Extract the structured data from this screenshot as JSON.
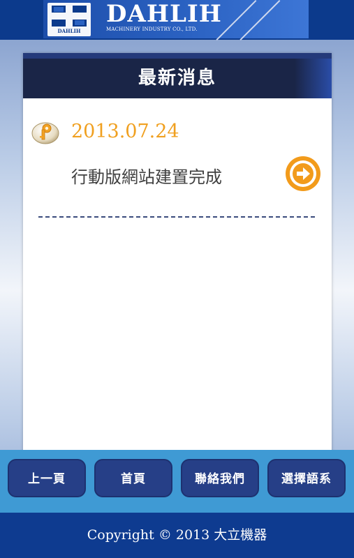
{
  "header": {
    "logo_small_text": "DAHLIH",
    "brand_name": "DAHLIH",
    "brand_subtitle": "MACHINERY INDUSTRY CO., LTD."
  },
  "panel": {
    "title": "最新消息",
    "news": [
      {
        "date": "2013.07.24",
        "title": "行動版網站建置完成",
        "icon": "key-icon",
        "action_icon": "arrow-right-circle-icon"
      }
    ]
  },
  "nav": {
    "prev": "上一頁",
    "home": "首頁",
    "contact": "聯絡我們",
    "language": "選擇語系"
  },
  "footer": {
    "copyright": "Copyright © 2013 大立機器"
  },
  "colors": {
    "header_bg": "#0c3a8c",
    "panel_title_bg": "#1a2547",
    "date_color": "#f0a020",
    "nav_bg": "#3f9ad4",
    "nav_button_bg": "#263f87",
    "footer_bg": "#0e3b90"
  }
}
